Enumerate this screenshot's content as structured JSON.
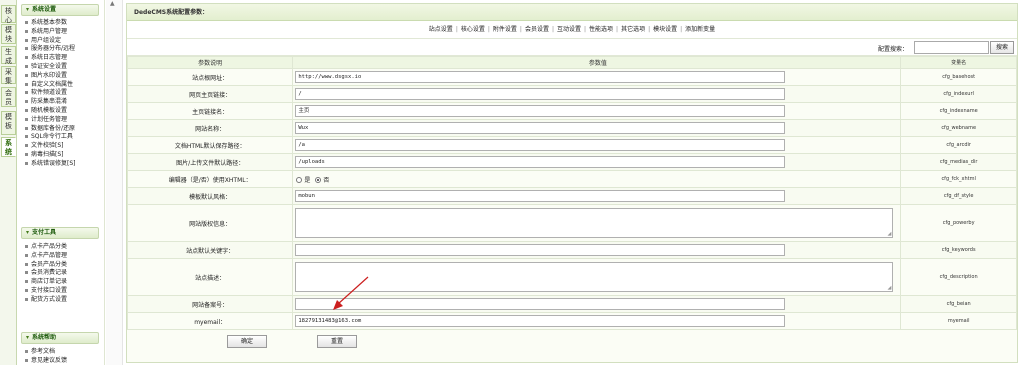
{
  "vtabs": [
    "核心",
    "模块",
    "生成",
    "采集",
    "会员",
    "模板",
    "系统"
  ],
  "menu": {
    "sections": [
      {
        "title": "系统设置",
        "items": [
          "系统基本参数",
          "系统用户管理",
          "用户组设定",
          "服务器分布/远程",
          "系统日志管理",
          "验证安全设置",
          "图片水印设置",
          "自定义文档属性",
          "软件频道设置",
          "防采集串混淆",
          "随机模板设置",
          "计划任务管理",
          "数据库备份/还原",
          "SQL命令行工具",
          "文件校验[S]",
          "病毒扫描[S]",
          "系统错误修复[S]"
        ]
      },
      {
        "title": "支付工具",
        "items": [
          "点卡产品分类",
          "点卡产品管理",
          "会员产品分类",
          "会员消费记录",
          "商店订单记录",
          "支付接口设置",
          "配货方式设置"
        ]
      },
      {
        "title": "系统帮助",
        "items": [
          "参考文档",
          "意见建议反馈"
        ]
      }
    ]
  },
  "main": {
    "title": "DedeCMS系统配置参数：",
    "nav": [
      "站点设置",
      "核心设置",
      "附件设置",
      "会员设置",
      "互动设置",
      "性能选项",
      "其它选项",
      "模块设置",
      "添加新变量"
    ],
    "search": {
      "label": "配置搜索：",
      "value": "",
      "button": "搜索"
    },
    "table": {
      "headers": [
        "参数说明",
        "参数值",
        "变量名"
      ],
      "rows": [
        {
          "label": "站点根网址：",
          "type": "input",
          "value": "http://www.dsgsx.io",
          "var": "cfg_basehost"
        },
        {
          "label": "网页主页链接：",
          "type": "input",
          "value": "/",
          "var": "cfg_indexurl"
        },
        {
          "label": "主页链接名：",
          "type": "input",
          "value": "主页",
          "var": "cfg_indexname"
        },
        {
          "label": "网站名称：",
          "type": "input",
          "value": "Wux",
          "var": "cfg_webname"
        },
        {
          "label": "文档HTML默认保存路径：",
          "type": "input",
          "value": "/a",
          "var": "cfg_arcdir"
        },
        {
          "label": "图片/上传文件默认路径：",
          "type": "input",
          "value": "/uploads",
          "var": "cfg_medias_dir"
        },
        {
          "label": "编辑器（是/否）使用XHTML：",
          "type": "radio",
          "options": [
            "是",
            "否"
          ],
          "selected": "否",
          "var": "cfg_fck_xhtml"
        },
        {
          "label": "模板默认风格：",
          "type": "input",
          "value": "mobun",
          "var": "cfg_df_style"
        },
        {
          "label": "网站版权信息：",
          "type": "textarea",
          "value": "",
          "var": "cfg_powerby"
        },
        {
          "label": "站点默认关键字：",
          "type": "input",
          "value": "",
          "var": "cfg_keywords"
        },
        {
          "label": "站点描述：",
          "type": "textarea",
          "value": "",
          "var": "cfg_description"
        },
        {
          "label": "网站备案号：",
          "type": "input",
          "value": "",
          "var": "cfg_beian"
        },
        {
          "label": "myemail：",
          "type": "input",
          "value": "18279131483@163.com",
          "var": "myemail"
        }
      ]
    },
    "buttons": {
      "confirm": "确定",
      "reset": "重置"
    }
  },
  "annotation": {
    "color": "#cc1f1f"
  }
}
